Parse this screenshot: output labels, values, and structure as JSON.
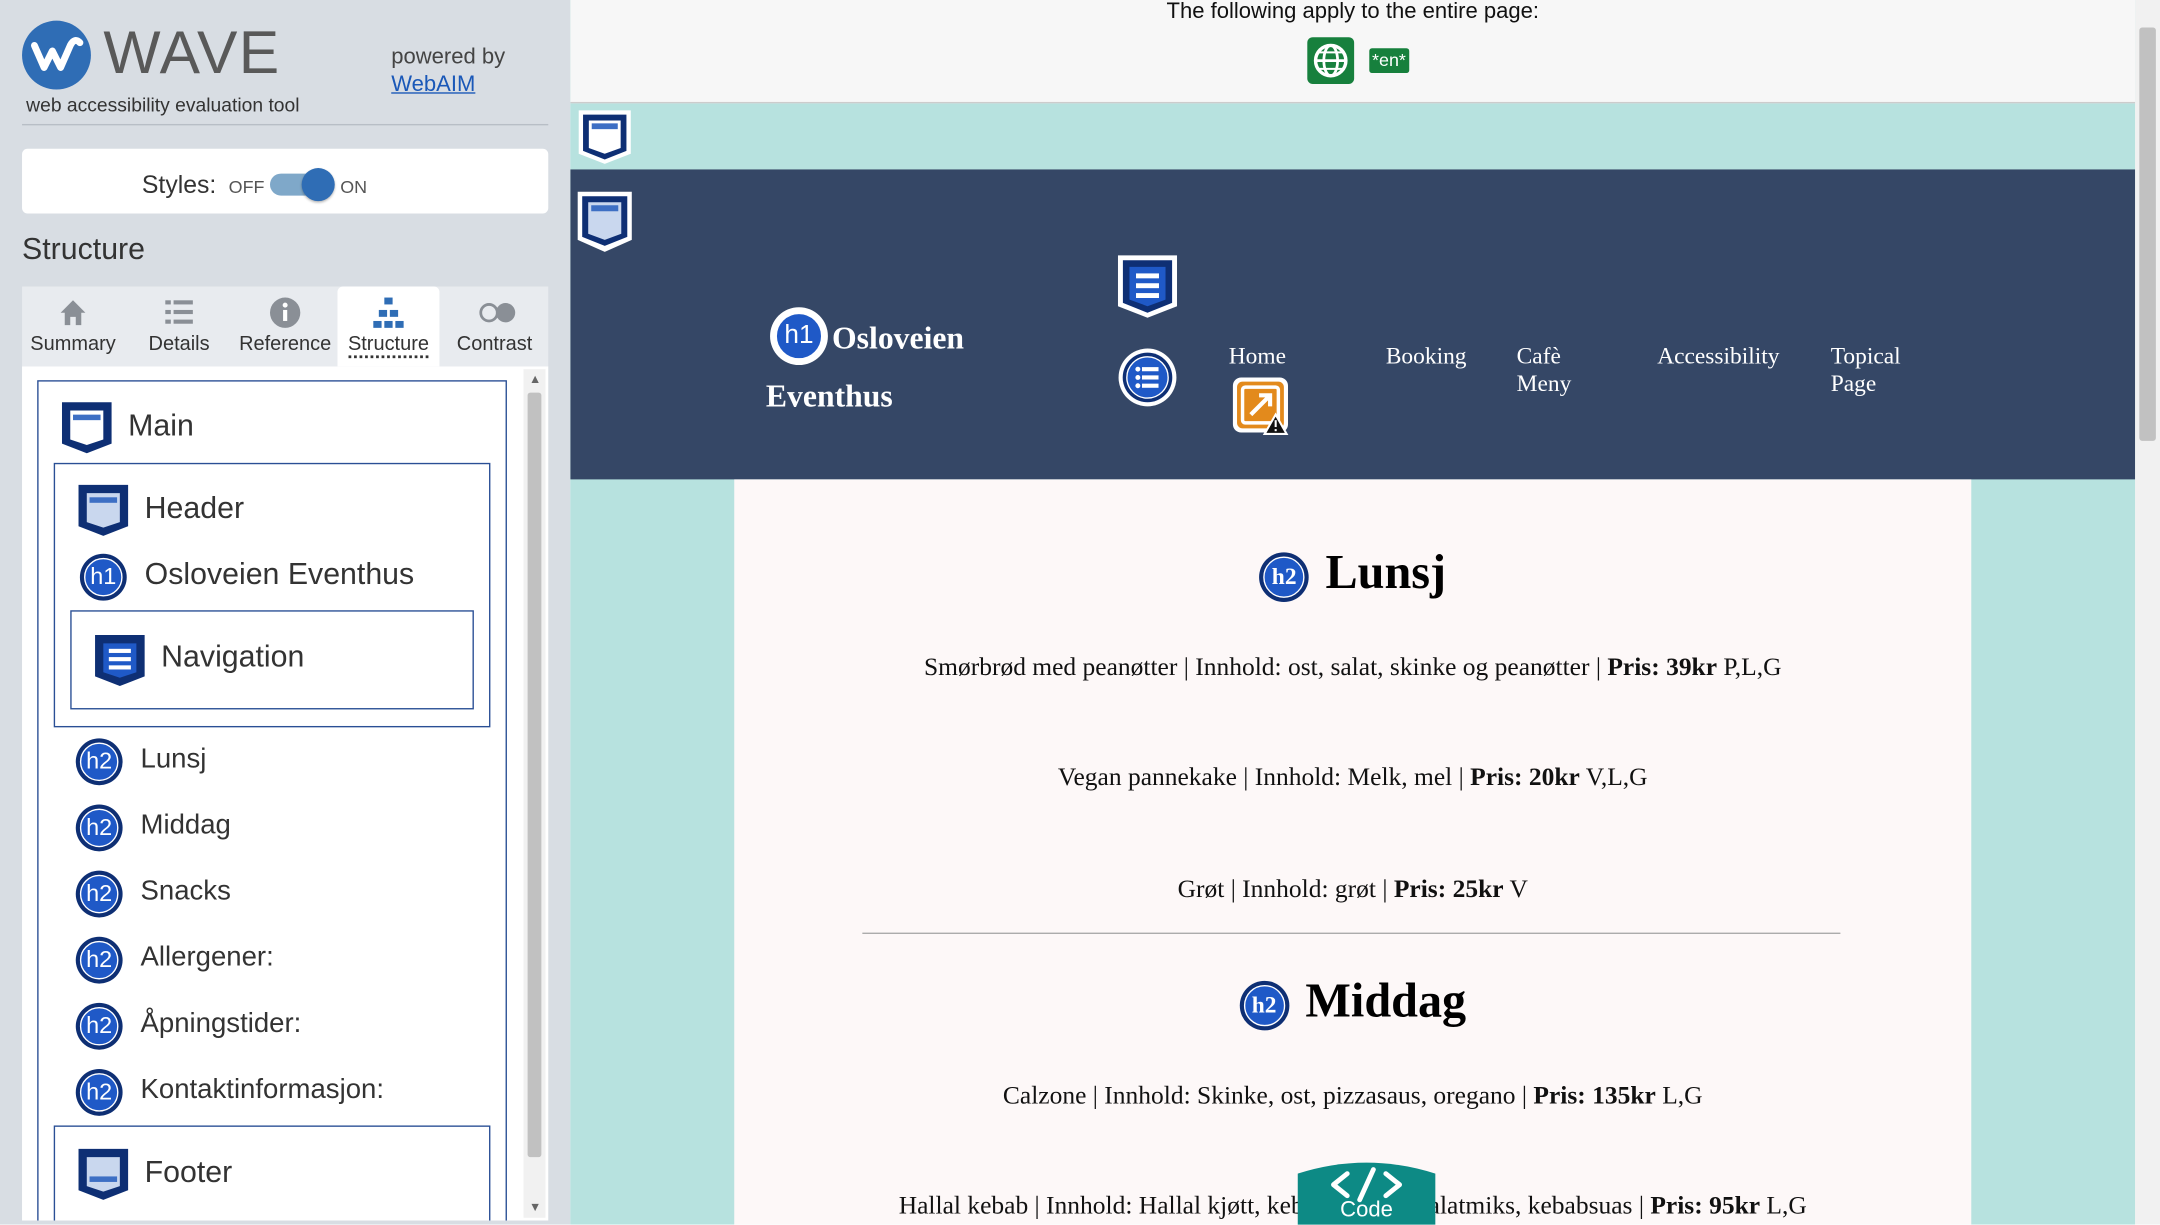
{
  "wave": {
    "logo_text": "WAVE",
    "tagline": "web accessibility evaluation tool",
    "powered_by": "powered by",
    "webaim_link": "WebAIM",
    "styles_label": "Styles:",
    "styles_off": "OFF",
    "styles_on": "ON",
    "section_title": "Structure",
    "tabs": [
      {
        "label": "Summary",
        "icon": "home-icon"
      },
      {
        "label": "Details",
        "icon": "list-icon"
      },
      {
        "label": "Reference",
        "icon": "info-icon"
      },
      {
        "label": "Structure",
        "icon": "structure-icon",
        "active": true
      },
      {
        "label": "Contrast",
        "icon": "contrast-icon"
      }
    ],
    "structure": {
      "main": "Main",
      "header": "Header",
      "h1": "Osloveien Eventhus",
      "navigation": "Navigation",
      "headings": [
        "Lunsj",
        "Middag",
        "Snacks",
        "Allergener:",
        "Åpningstider:",
        "Kontaktinformasjon:"
      ],
      "footer": "Footer",
      "h1_badge": "h1",
      "h2_badge": "h2"
    }
  },
  "page": {
    "topbar_text": "The following apply to the entire page:",
    "lang_badge": "*en*",
    "site_title_line1": "Osloveien",
    "site_title_line2": "Eventhus",
    "nav": {
      "home": "Home",
      "booking": "Booking",
      "cafe_1": "Cafè",
      "cafe_2": "Meny",
      "accessibility": "Accessibility",
      "topical_1": "Topical",
      "topical_2": "Page"
    },
    "sections": {
      "lunsj": {
        "title": "Lunsj",
        "items": [
          {
            "name": "Smørbrød med peanøtter",
            "contents": "Innhold: ost, salat, skinke og peanøtter",
            "price": "Pris: 39kr",
            "tags": "P,L,G"
          },
          {
            "name": "Vegan pannekake",
            "contents": "Innhold: Melk, mel",
            "price": "Pris: 20kr",
            "tags": "V,L,G"
          },
          {
            "name": "Grøt",
            "contents": "Innhold: grøt",
            "price": "Pris: 25kr",
            "tags": "V"
          }
        ]
      },
      "middag": {
        "title": "Middag",
        "items": [
          {
            "name": "Calzone",
            "contents": "Innhold: Skinke, ost, pizzasaus, oregano",
            "price": "Pris: 135kr",
            "tags": "L,G"
          },
          {
            "name": "Hallal kebab",
            "contents": "Innhold: Hallal kjøtt, kebabkrydder, salatmiks, kebabsuas",
            "price": "Pris: 95kr",
            "tags": "L,G"
          }
        ]
      }
    },
    "code_button": "Code",
    "h2_badge": "h2",
    "h1_badge": "h1"
  },
  "colors": {
    "wave_blue": "#2f6db5",
    "header_bg": "#354766",
    "page_bg": "#b7e2df",
    "badge_green": "#17803d",
    "alert_orange": "#e38a1c"
  }
}
